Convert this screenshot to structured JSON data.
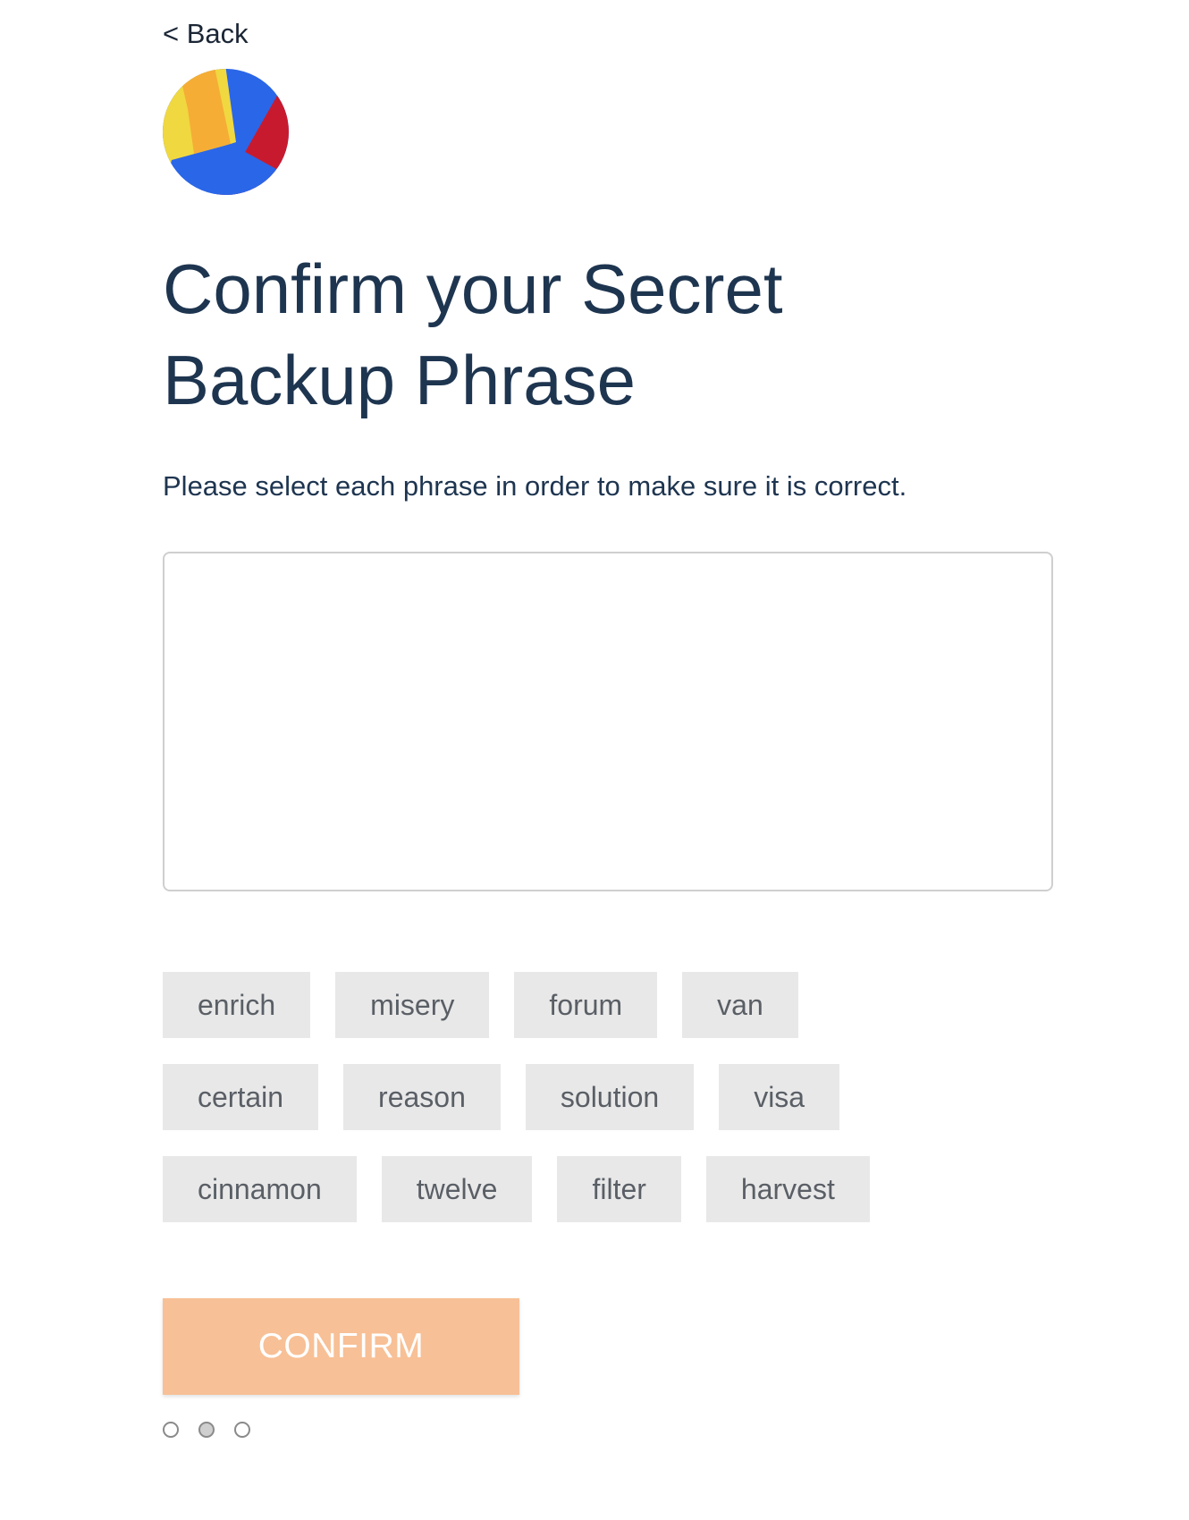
{
  "nav": {
    "back_label": "< Back"
  },
  "avatar": {
    "icon": "jazzicon-avatar",
    "colors": [
      "#2a66e8",
      "#f5ad36",
      "#f0d840",
      "#c81a2e"
    ]
  },
  "page": {
    "title": "Confirm your Secret Backup Phrase",
    "instructions": "Please select each phrase in order to make sure it is correct."
  },
  "selected_phrase": {
    "words": []
  },
  "word_rows": [
    [
      "enrich",
      "misery",
      "forum",
      "van"
    ],
    [
      "certain",
      "reason",
      "solution",
      "visa"
    ],
    [
      "cinnamon",
      "twelve",
      "filter",
      "harvest"
    ]
  ],
  "confirm_button": {
    "label": "CONFIRM",
    "enabled": false,
    "color": "#f8c096"
  },
  "pager": {
    "total": 3,
    "current": 2
  }
}
